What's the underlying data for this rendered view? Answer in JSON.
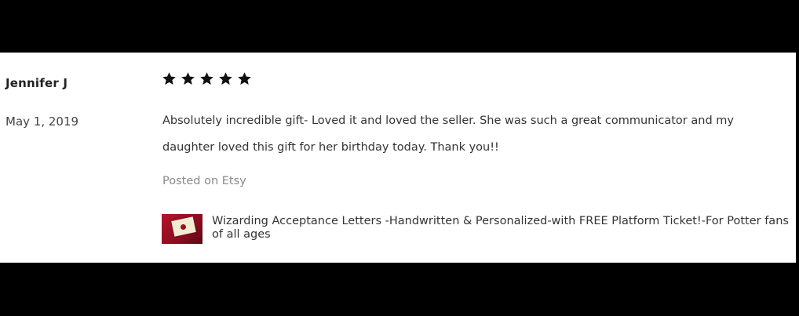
{
  "review": {
    "reviewer": "Jennifer J",
    "date": "May 1, 2019",
    "rating": 5,
    "rating_max": 5,
    "text": "Absolutely incredible gift- Loved it and loved the seller. She was such a great communicator and my daughter loved this gift for her birthday today. Thank you!!",
    "source": "Posted on Etsy",
    "product": {
      "title": "Wizarding Acceptance Letters -Handwritten & Personalized-with FREE Platform Ticket!-For Potter fans of all ages"
    }
  },
  "icons": {
    "star": "star-filled-icon"
  },
  "colors": {
    "background": "#ffffff",
    "frame": "#000000",
    "text": "#333333",
    "muted": "#8a8a8a",
    "star": "#111111"
  }
}
